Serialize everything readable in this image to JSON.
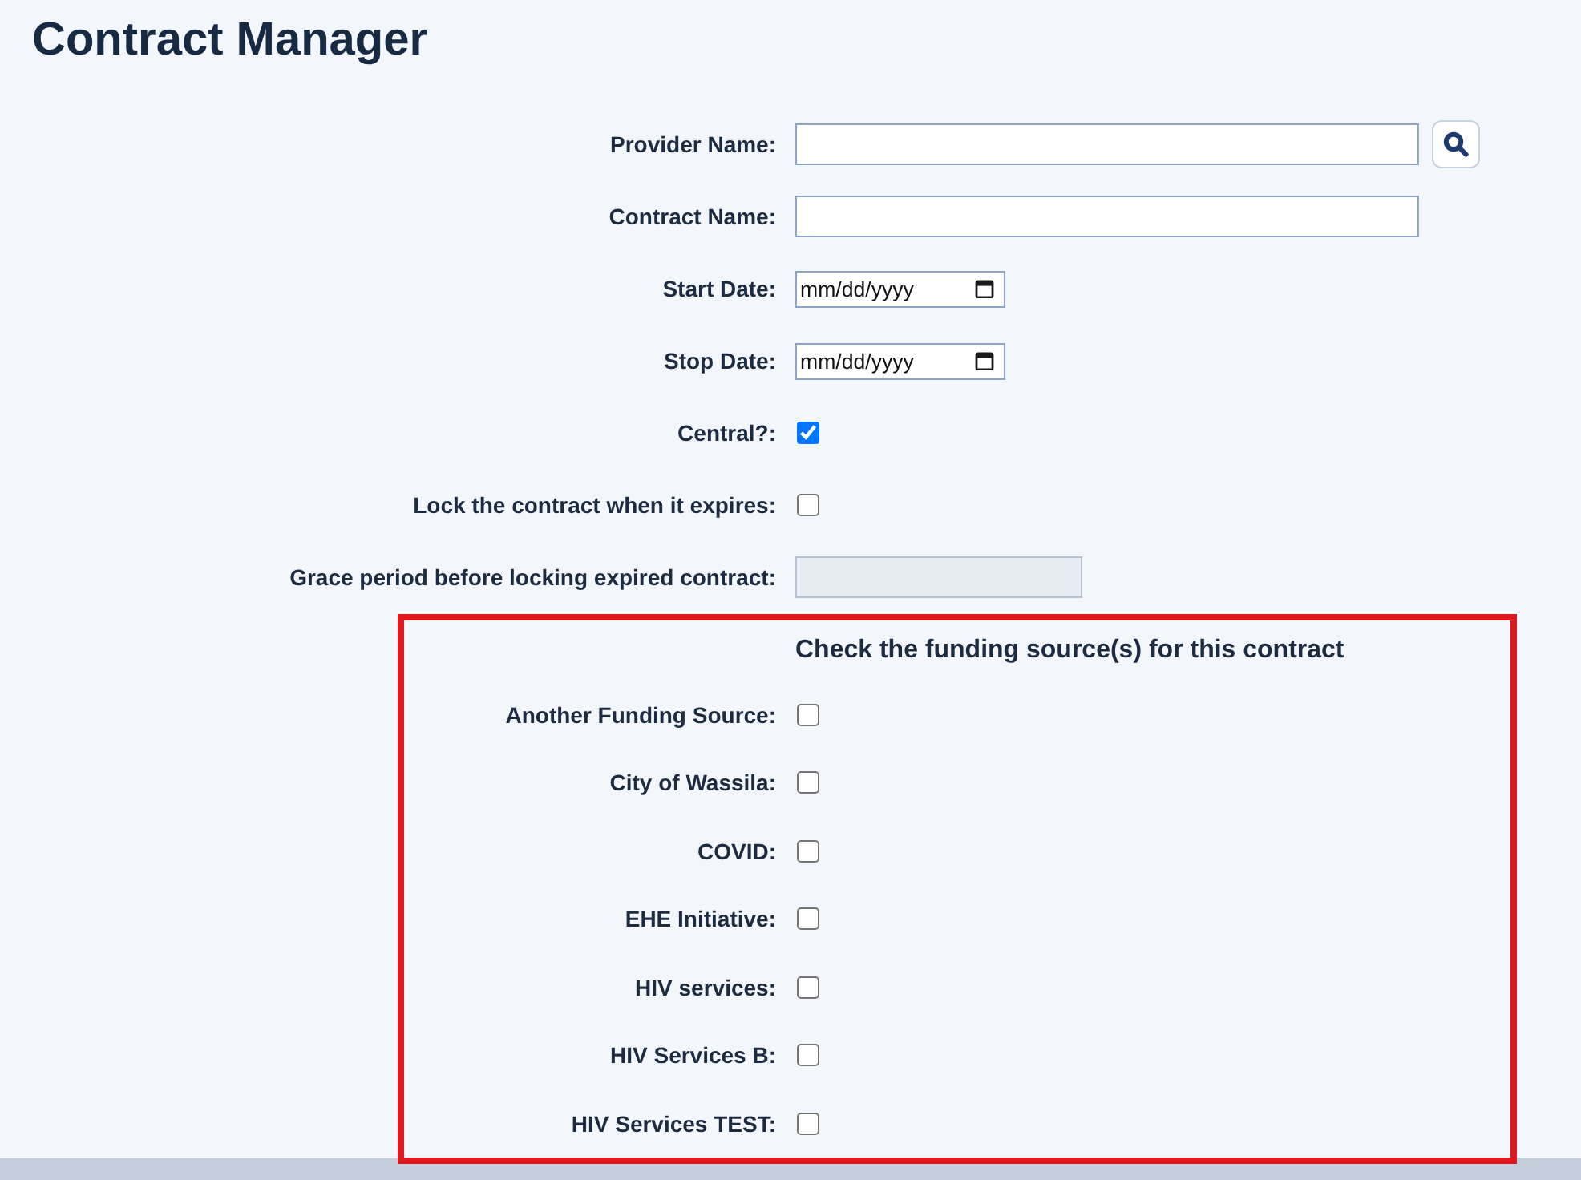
{
  "title": "Contract Manager",
  "fields": [
    {
      "kind": "text",
      "label": "Provider Name:",
      "disabled": false,
      "search": true
    },
    {
      "kind": "text",
      "label": "Contract Name:",
      "disabled": false
    },
    {
      "kind": "date",
      "label": "Start Date:",
      "placeholder": "mm/dd/yyyy"
    },
    {
      "kind": "date",
      "label": "Stop Date:",
      "placeholder": "mm/dd/yyyy"
    },
    {
      "kind": "checkbox",
      "label": "Central?:",
      "checked": true
    },
    {
      "kind": "checkbox",
      "label": "Lock the contract when it expires:",
      "checked": false
    },
    {
      "kind": "number",
      "label": "Grace period before locking expired contract:",
      "disabled": true
    }
  ],
  "funding": {
    "heading": "Check the funding source(s) for this contract",
    "sources": [
      {
        "label": "Another Funding Source:",
        "checked": false
      },
      {
        "label": "City of Wassila:",
        "checked": false
      },
      {
        "label": "COVID:",
        "checked": false
      },
      {
        "label": "EHE Initiative:",
        "checked": false
      },
      {
        "label": "HIV services:",
        "checked": false
      },
      {
        "label": "HIV Services B:",
        "checked": false
      },
      {
        "label": "HIV Services TEST:",
        "checked": false
      }
    ]
  }
}
